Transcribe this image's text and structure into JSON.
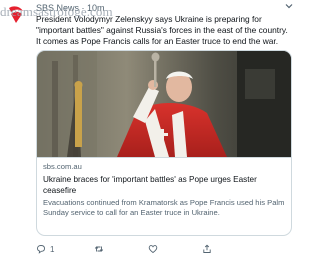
{
  "tweet": {
    "author_name": "SBS News",
    "separator": "·",
    "time": "10m",
    "text": "President Volodymyr Zelenskyy says Ukraine is preparing for \"important battles\" against Russia's forces in the east of the country. It comes as Pope Francis calls for an Easter truce to end the war.",
    "menu_icon": "chevron-down-icon"
  },
  "card": {
    "domain": "sbs.com.au",
    "title": "Ukraine braces for 'important battles' as Pope urges Easter ceasefire",
    "description": "Evacuations continued from Kramatorsk as Pope Francis used his Palm Sunday service to call for an Easter truce in Ukraine."
  },
  "actions": {
    "reply_count": "1",
    "retweet_count": "",
    "like_count": "",
    "icons": [
      "reply-icon",
      "retweet-icon",
      "like-icon",
      "share-icon"
    ]
  },
  "watermark": {
    "text": "dreamsastrologe.com"
  },
  "colors": {
    "brand_red": "#e5202e",
    "secondary_text": "#536471",
    "primary_text": "#0f1419",
    "border": "#cfd9de"
  }
}
